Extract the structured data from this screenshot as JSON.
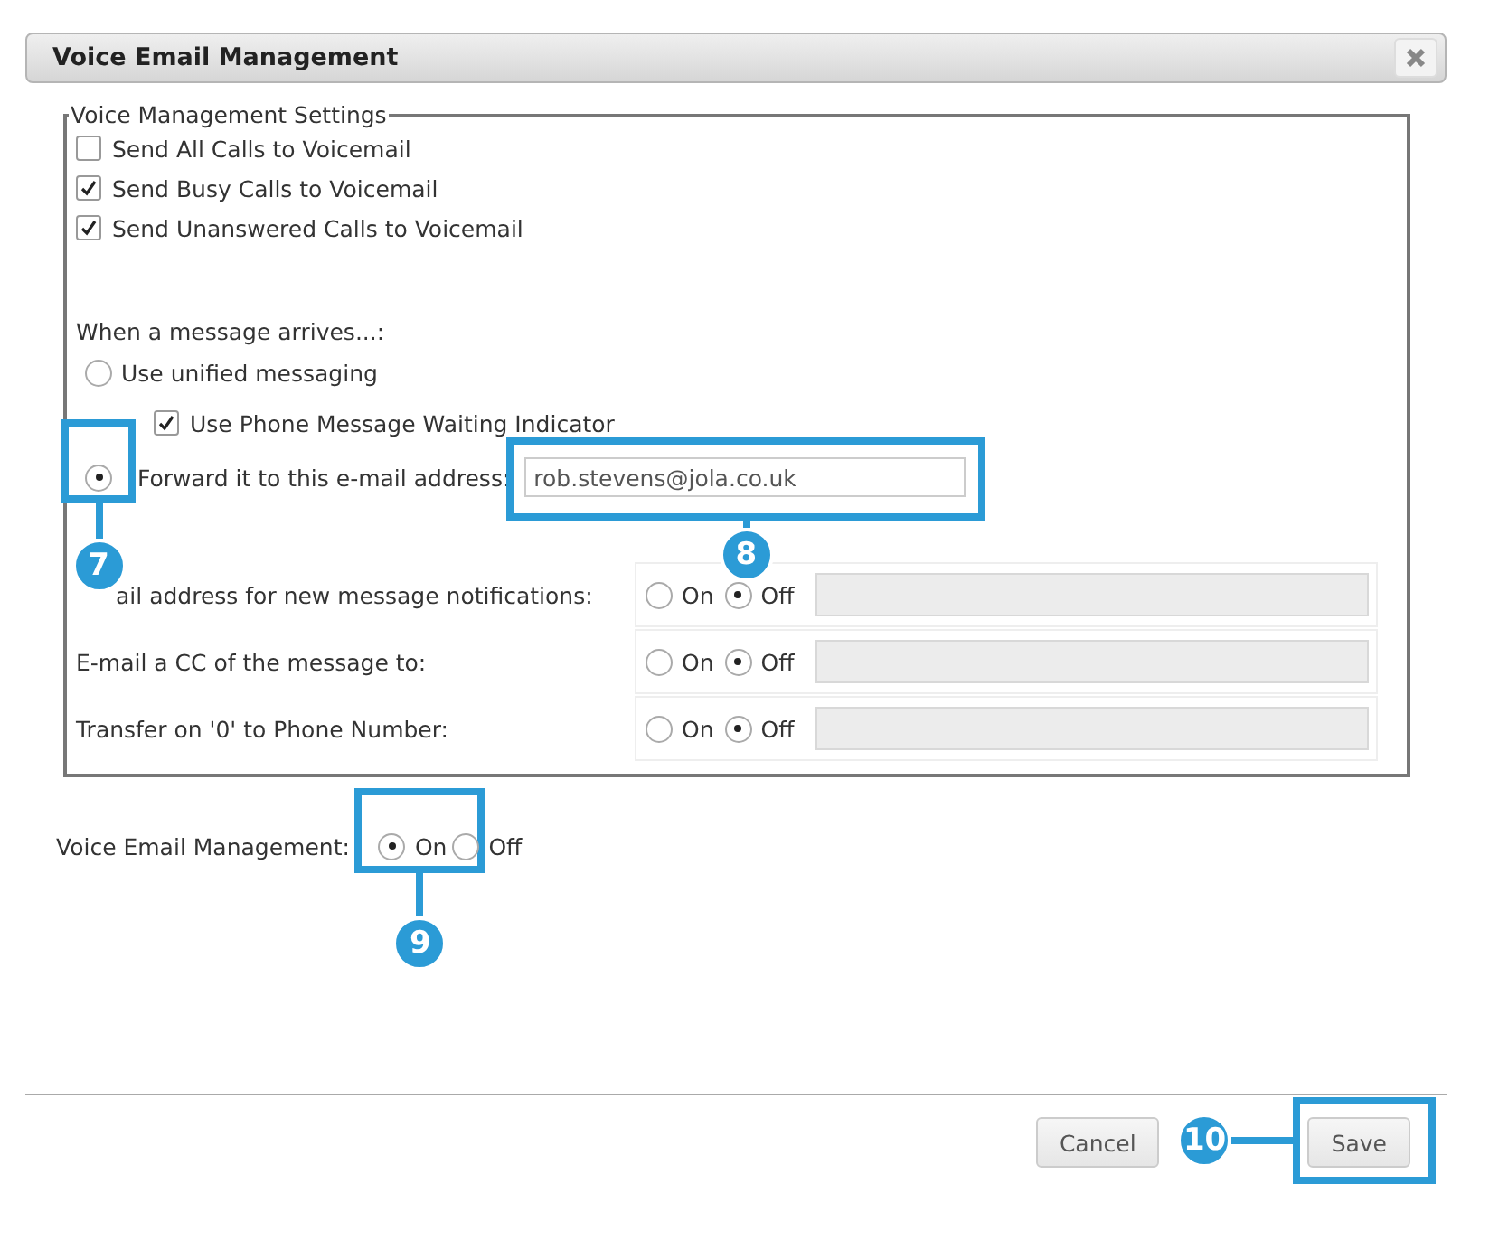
{
  "window": {
    "title": "Voice Email Management"
  },
  "settings": {
    "legend": "Voice Management Settings",
    "options": [
      {
        "label": "Send All Calls to Voicemail",
        "checked": false
      },
      {
        "label": "Send Busy Calls to Voicemail",
        "checked": true
      },
      {
        "label": "Send Unanswered Calls to Voicemail",
        "checked": true
      }
    ],
    "arrival_label": "When a message arrives...:",
    "unified": {
      "label": "Use unified messaging",
      "selected": false
    },
    "mwi": {
      "label": "Use Phone Message Waiting Indicator",
      "checked": true
    },
    "forward": {
      "label": "Forward it to this e-mail address:",
      "selected": true,
      "value": "rob.stevens@jola.co.uk",
      "radio_callout": "7",
      "field_callout": "8"
    },
    "rows": [
      {
        "label": "ail address for new message notifications:",
        "choices": [
          {
            "label": "On",
            "selected": false
          },
          {
            "label": "Off",
            "selected": true
          }
        ]
      },
      {
        "label": "E-mail a CC of the message to:",
        "choices": [
          {
            "label": "On",
            "selected": false
          },
          {
            "label": "Off",
            "selected": true
          }
        ]
      },
      {
        "label": "Transfer on '0' to Phone Number:",
        "choices": [
          {
            "label": "On",
            "selected": false
          },
          {
            "label": "Off",
            "selected": true
          }
        ]
      }
    ]
  },
  "management": {
    "label": "Voice Email Management:",
    "callout": "9",
    "choices": [
      {
        "label": "On",
        "selected": true
      },
      {
        "label": "Off",
        "selected": false
      }
    ]
  },
  "buttons": [
    {
      "label": "Cancel"
    },
    {
      "label": "Save",
      "callout": "10"
    }
  ]
}
